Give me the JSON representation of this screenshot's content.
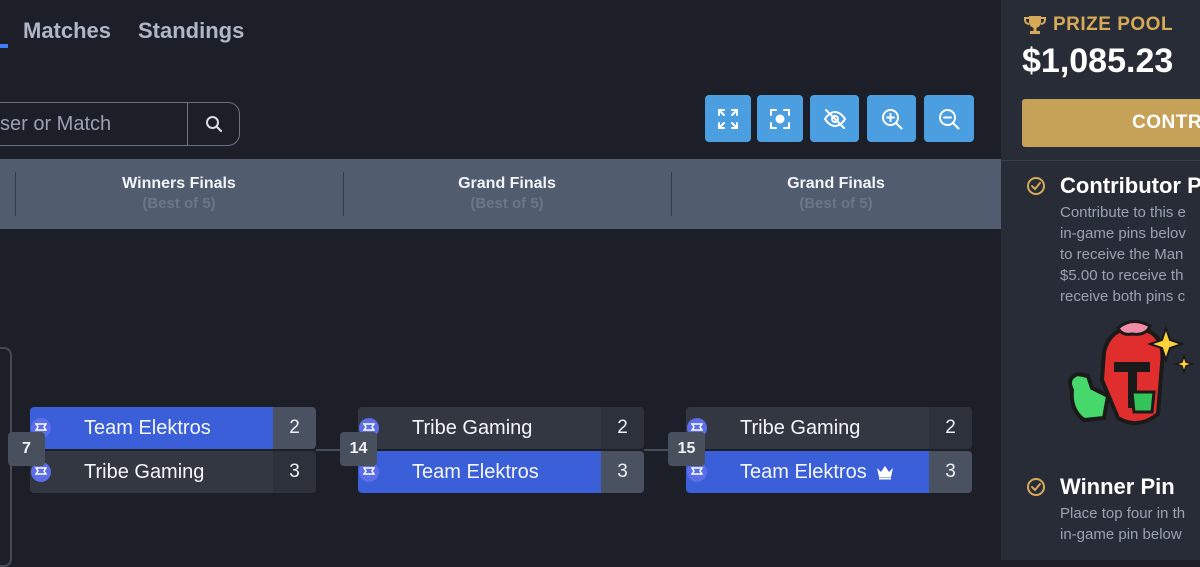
{
  "tabs": {
    "matches": "Matches",
    "standings": "Standings"
  },
  "search": {
    "placeholder": "y User or Match"
  },
  "toolbar": {
    "buttons": [
      "fullscreen-icon",
      "focus-icon",
      "hide-icon",
      "zoom-in-icon",
      "zoom-out-icon"
    ],
    "color": "#4b9fe0"
  },
  "rounds": [
    {
      "title": "Winners Finals",
      "subtitle": "(Best of 5)"
    },
    {
      "title": "Grand Finals",
      "subtitle": "(Best of 5)"
    },
    {
      "title": "Grand Finals",
      "subtitle": "(Best of 5)"
    }
  ],
  "matches": [
    {
      "number": "7",
      "teams": [
        {
          "name": "Team Elektros",
          "score": "2",
          "winner": false
        },
        {
          "name": "Tribe Gaming",
          "score": "3",
          "winner": true
        }
      ]
    },
    {
      "number": "14",
      "teams": [
        {
          "name": "Tribe Gaming",
          "score": "2",
          "winner": false
        },
        {
          "name": "Team Elektros",
          "score": "3",
          "winner": true
        }
      ]
    },
    {
      "number": "15",
      "teams": [
        {
          "name": "Tribe Gaming",
          "score": "2",
          "winner": false
        },
        {
          "name": "Team Elektros",
          "score": "3",
          "winner": true,
          "champion_icon": "crown-icon"
        }
      ]
    }
  ],
  "panel": {
    "prize_label": "PRIZE POOL",
    "prize_amount": "$1,085.23",
    "contribute_label": "CONTR",
    "contributor_pin": {
      "title": "Contributor P",
      "text": "Contribute to this e\nin-game pins belov\nto receive the Man\n$5.00 to receive th\nreceive both pins c"
    },
    "winner_pin": {
      "title": "Winner Pin",
      "text": "Place top four in th\nin-game pin below"
    }
  },
  "colors": {
    "accent": "#3a5fd8",
    "gold": "#c5a257",
    "background": "#1c1f27"
  }
}
